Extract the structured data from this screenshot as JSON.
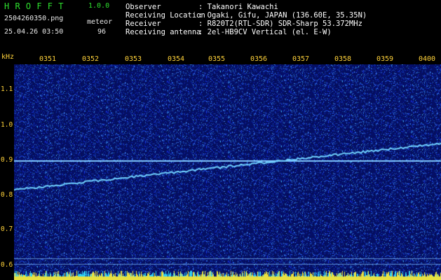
{
  "app": {
    "title": "H R O F F T",
    "version": "1.0.0",
    "filename": "2504260350.png",
    "datetime": "25.04.26 03:50",
    "meteor_label": "meteor",
    "meteor_count": "96"
  },
  "info": [
    {
      "key": "Observer",
      "value": ": Takanori Kawachi"
    },
    {
      "key": "Receiving Location",
      "value": ": Ogaki, Gifu, JAPAN (136.60E, 35.35N)"
    },
    {
      "key": "Receiver",
      "value": ": R820T2(RTL-SDR) SDR-Sharp 53.372MHz"
    },
    {
      "key": "Receiving antenna",
      "value": ": 2el-HB9CV Vertical (el. E-W)"
    }
  ],
  "time_axis": {
    "ticks": [
      "0351",
      "0352",
      "0353",
      "0354",
      "0355",
      "0356",
      "0357",
      "0358",
      "0359",
      "0400"
    ]
  },
  "freq_axis": {
    "unit": "kHz",
    "ticks": [
      "1.1",
      "1.0",
      "0.9",
      "0.8",
      "0.7",
      "0.6"
    ]
  },
  "colors": {
    "background": "#000000",
    "header_title": "#2ee02e",
    "axis_labels": "#ffd23a",
    "spectrogram_base": "#0a1a60",
    "signal_trace": "#6fd0ff",
    "reference_line": "#7fc8ff"
  }
}
